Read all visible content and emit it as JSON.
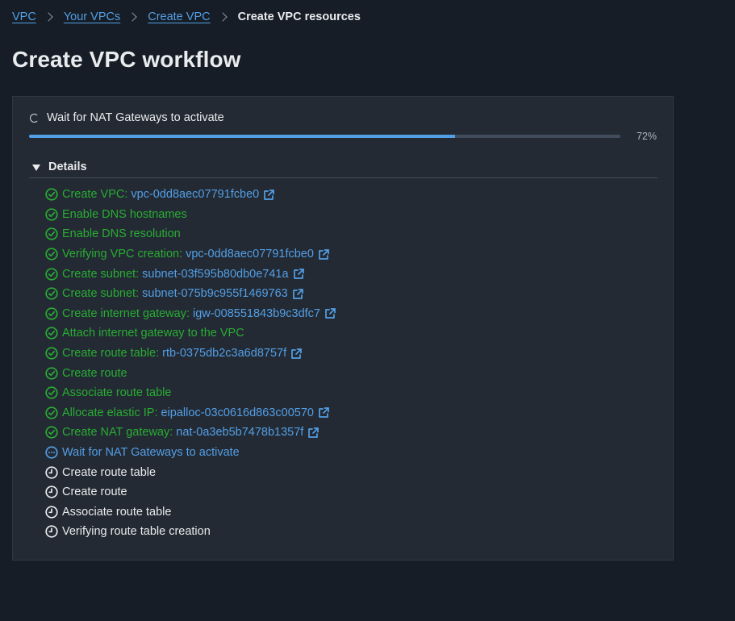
{
  "breadcrumb": {
    "items": [
      "VPC",
      "Your VPCs",
      "Create VPC"
    ],
    "current": "Create VPC resources"
  },
  "page_title": "Create VPC workflow",
  "status": {
    "label": "Wait for NAT Gateways to activate",
    "progress_percent": 72,
    "progress_text": "72%"
  },
  "details": {
    "toggle_label": "Details",
    "steps": [
      {
        "status": "done",
        "label": "Create VPC:",
        "link": "vpc-0dd8aec07791fcbe0"
      },
      {
        "status": "done",
        "label": "Enable DNS hostnames",
        "link": null
      },
      {
        "status": "done",
        "label": "Enable DNS resolution",
        "link": null
      },
      {
        "status": "done",
        "label": "Verifying VPC creation:",
        "link": "vpc-0dd8aec07791fcbe0"
      },
      {
        "status": "done",
        "label": "Create subnet:",
        "link": "subnet-03f595b80db0e741a"
      },
      {
        "status": "done",
        "label": "Create subnet:",
        "link": "subnet-075b9c955f1469763"
      },
      {
        "status": "done",
        "label": "Create internet gateway:",
        "link": "igw-008551843b9c3dfc7"
      },
      {
        "status": "done",
        "label": "Attach internet gateway to the VPC",
        "link": null
      },
      {
        "status": "done",
        "label": "Create route table:",
        "link": "rtb-0375db2c3a6d8757f"
      },
      {
        "status": "done",
        "label": "Create route",
        "link": null
      },
      {
        "status": "done",
        "label": "Associate route table",
        "link": null
      },
      {
        "status": "done",
        "label": "Allocate elastic IP:",
        "link": "eipalloc-03c0616d863c00570"
      },
      {
        "status": "done",
        "label": "Create NAT gateway:",
        "link": "nat-0a3eb5b7478b1357f"
      },
      {
        "status": "active",
        "label": "Wait for NAT Gateways to activate",
        "link": null
      },
      {
        "status": "pending",
        "label": "Create route table",
        "link": null
      },
      {
        "status": "pending",
        "label": "Create route",
        "link": null
      },
      {
        "status": "pending",
        "label": "Associate route table",
        "link": null
      },
      {
        "status": "pending",
        "label": "Verifying route table creation",
        "link": null
      }
    ]
  },
  "colors": {
    "success": "#29ad32",
    "link": "#539fe5",
    "text": "#e9ebed",
    "background": "#161d26",
    "panel": "#232a34"
  },
  "icons": {
    "done": "status-success-icon",
    "active": "status-in-progress-icon",
    "pending": "status-pending-icon",
    "external": "external-link-icon"
  }
}
